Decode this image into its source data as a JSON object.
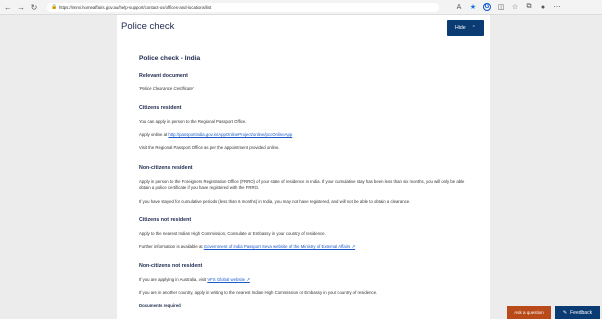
{
  "browser": {
    "url": "https://immi.homeaffairs.gov.au/help-support/contact-us/offices-and-locations/list"
  },
  "header": {
    "title": "Police check",
    "hide_label": "Hide"
  },
  "content": {
    "page_heading": "Police check - India",
    "relevant_document_heading": "Relevant document",
    "relevant_document_value": "'Police Clearance Certificate'",
    "citizens_resident": {
      "heading": "Citizens resident",
      "line1": "You can apply in person to the Regional Passport Office.",
      "line2_prefix": "Apply online at ",
      "line2_link": "http://passportindia.gov.in/AppOnlineProject/online/pccOnlineApp",
      "line3": "Visit the Regional Passport Office as per the appointment provided online."
    },
    "non_citizens_resident": {
      "heading": "Non-citizens resident",
      "para1": "Apply in person to the Foreigners Registration Office (FRRO) of your state of residence in India. If your cumulative stay has been less than six months, you will only be able obtain a police certificate if you have registered with the FRRO.",
      "para2": "If you have stayed for cumulative periods (less than 6 months) in India, you may not have registered, and will not be able to obtain a clearance."
    },
    "citizens_not_resident": {
      "heading": "Citizens not resident",
      "line1": "Apply to the nearest Indian High Commission, Consulate or Embassy in your country of residence.",
      "line2_prefix": "Further information is available at ",
      "line2_link": "Government of India Passport Seva website of the Ministry of External Affairs ↗"
    },
    "non_citizens_not_resident": {
      "heading": "Non-citizens not resident",
      "line1_prefix": "If you are applying in Australia, visit ",
      "line1_link": "VFS Global website ↗",
      "line2": "If you are in another country, apply in writing to the nearest Indian High Commission or Embassy in your country of residence."
    },
    "documents_required_heading": "Documents required"
  },
  "floating": {
    "ask_label": "Ask a question",
    "feedback_label": "Feedback"
  }
}
